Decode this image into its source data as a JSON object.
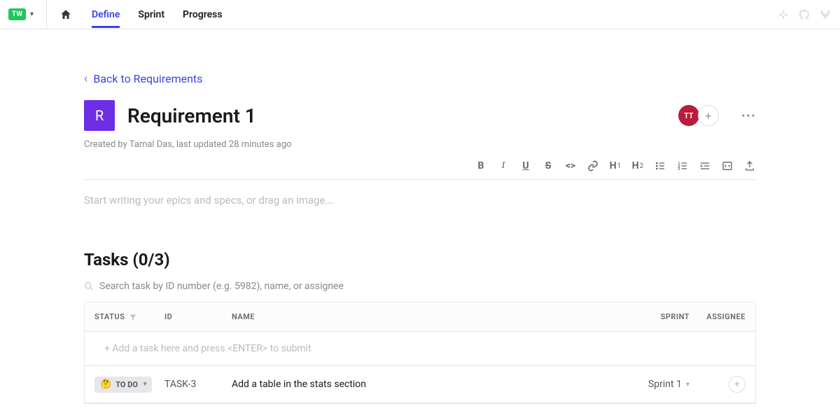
{
  "topbar": {
    "workspace_badge": "TW",
    "nav": {
      "define": "Define",
      "sprint": "Sprint",
      "progress": "Progress"
    }
  },
  "back_link": "Back to Requirements",
  "requirement": {
    "badge_letter": "R",
    "title": "Requirement 1",
    "meta": "Created by Tamal Das, last updated 28 minutes ago",
    "avatar_initials": "TT"
  },
  "editor": {
    "placeholder": "Start writing your epics and specs, or drag an image..."
  },
  "tasks": {
    "heading": "Tasks (0/3)",
    "search_placeholder": "Search task by ID number (e.g. 5982), name, or assignee",
    "columns": {
      "status": "STATUS",
      "id": "ID",
      "name": "NAME",
      "sprint": "SPRINT",
      "assignee": "ASSIGNEE"
    },
    "add_placeholder": "+ Add a task here and press <ENTER> to submit",
    "rows": [
      {
        "status": "TO DO",
        "id": "TASK-3",
        "name": "Add a table in the stats section",
        "sprint": "Sprint 1"
      }
    ]
  }
}
